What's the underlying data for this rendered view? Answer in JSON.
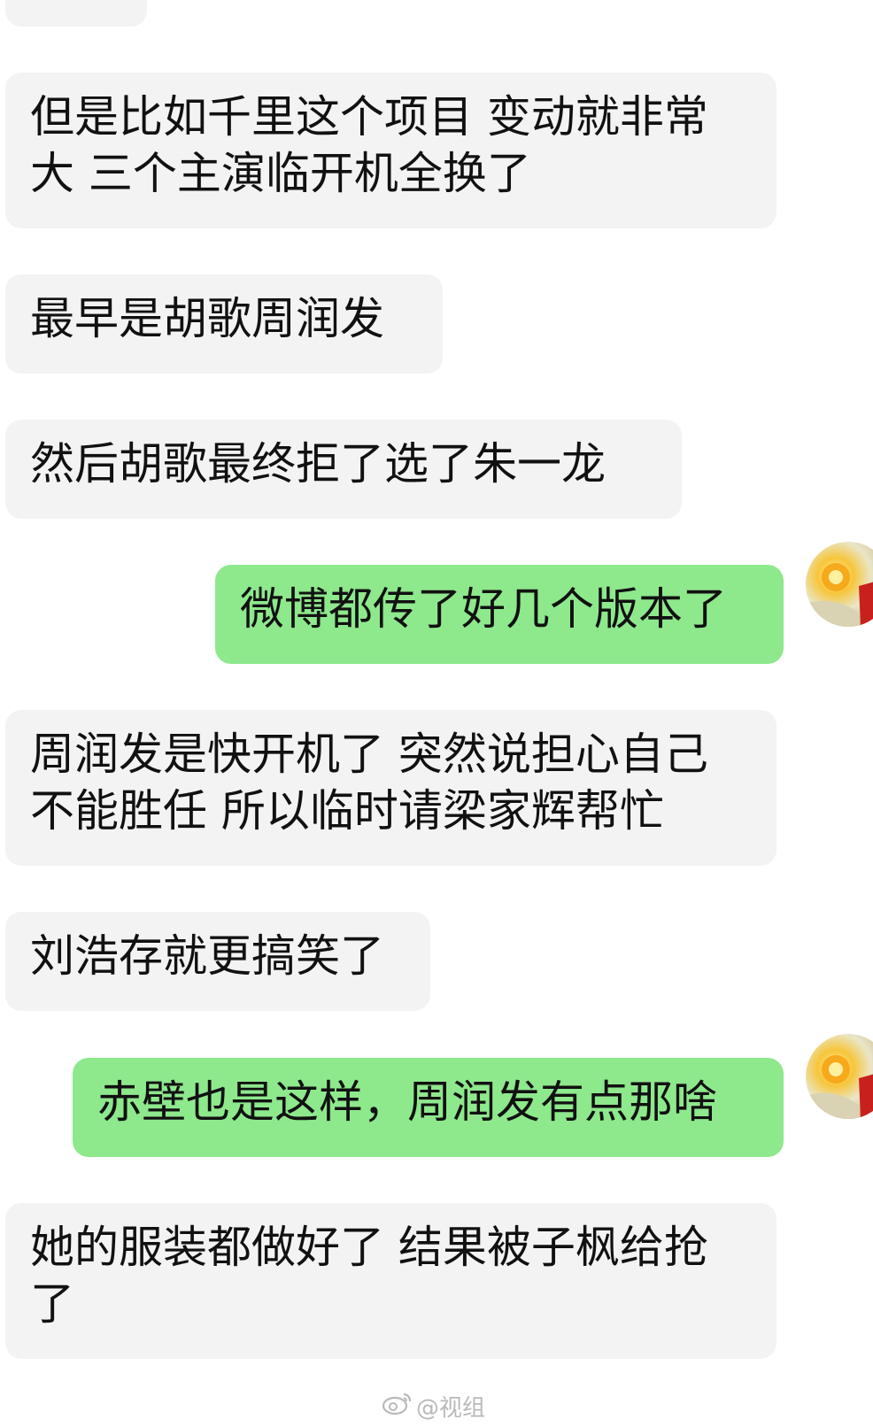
{
  "messages": [
    {
      "side": "in",
      "text": "但是比如千里这个项目 变动就非常大 三个主演临开机全换了"
    },
    {
      "side": "in",
      "text": "最早是胡歌周润发"
    },
    {
      "side": "in",
      "text": "然后胡歌最终拒了选了朱一龙"
    },
    {
      "side": "out",
      "text": "微博都传了好几个版本了"
    },
    {
      "side": "in",
      "text": "周润发是快开机了 突然说担心自己不能胜任 所以临时请梁家辉帮忙"
    },
    {
      "side": "in",
      "text": "刘浩存就更搞笑了"
    },
    {
      "side": "out",
      "text": "赤壁也是这样，周润发有点那啥"
    },
    {
      "side": "in",
      "text": "她的服装都做好了 结果被子枫给抢了"
    }
  ],
  "watermark": {
    "text": "@视组",
    "icon": "weibo-logo-icon"
  },
  "colors": {
    "incoming_bubble": "#f3f3f3",
    "outgoing_bubble": "#8ee88c",
    "text": "#111111"
  }
}
